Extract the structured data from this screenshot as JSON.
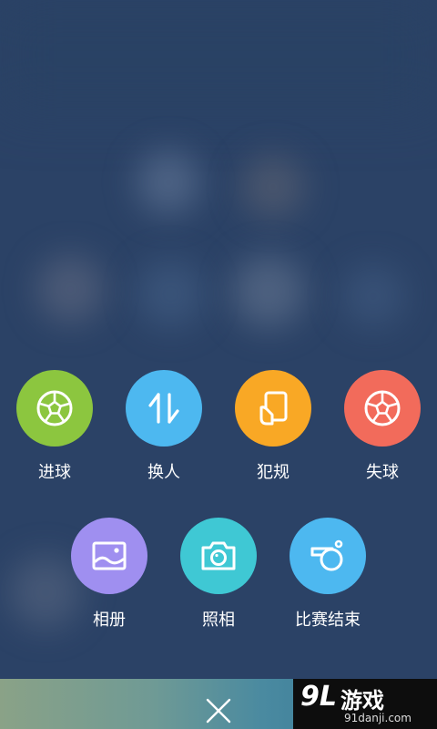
{
  "actions": {
    "goal": {
      "label": "进球",
      "color": "#8cc63f"
    },
    "substitute": {
      "label": "换人",
      "color": "#4db8f0"
    },
    "foul": {
      "label": "犯规",
      "color": "#f9a825"
    },
    "concede": {
      "label": "失球",
      "color": "#f26b5b"
    },
    "album": {
      "label": "相册",
      "color": "#9f8ff0"
    },
    "camera": {
      "label": "照相",
      "color": "#3fc8d4"
    },
    "end_match": {
      "label": "比赛结束",
      "color": "#4db8f0"
    }
  },
  "close_icon": "close-icon",
  "watermark": {
    "logo": "9L",
    "name": "游戏",
    "url": "91danji.com"
  }
}
